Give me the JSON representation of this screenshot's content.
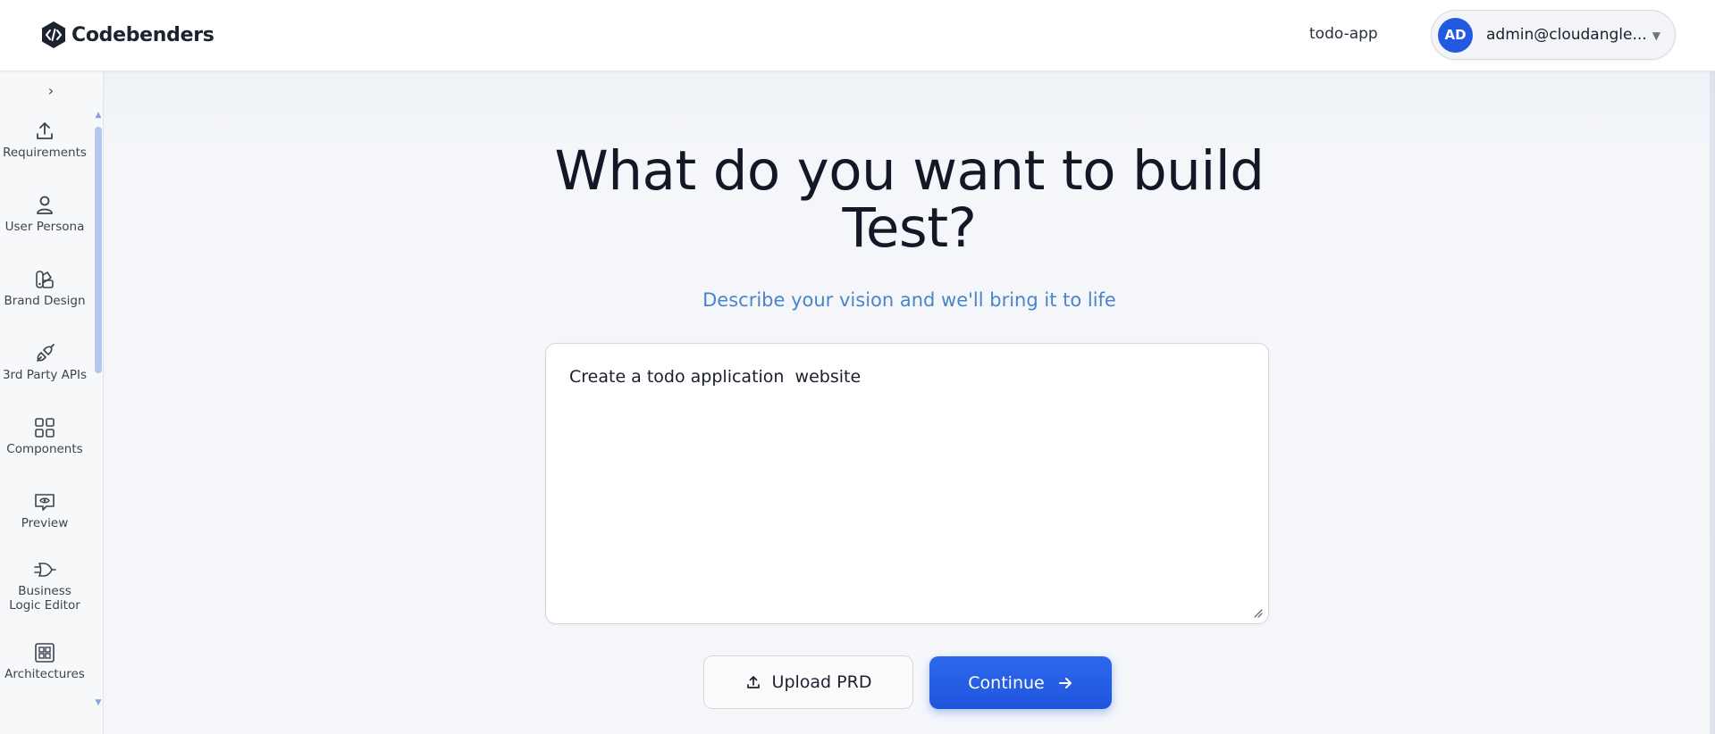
{
  "header": {
    "brand": "Codebenders",
    "project": "todo-app",
    "user": {
      "initials": "AD",
      "email": "admin@cloudangle..."
    }
  },
  "sidebar": {
    "items": [
      {
        "label": "Requirements",
        "icon": "upload-icon"
      },
      {
        "label": "User Persona",
        "icon": "user-icon"
      },
      {
        "label": "Brand Design",
        "icon": "palette-icon"
      },
      {
        "label": "3rd Party APIs",
        "icon": "plug-icon"
      },
      {
        "label": "Components",
        "icon": "grid-icon"
      },
      {
        "label": "Preview",
        "icon": "eye-icon"
      },
      {
        "label": "Business Logic Editor",
        "label_lines": [
          "Business",
          "Logic Editor"
        ],
        "icon": "logic-gate-icon"
      },
      {
        "label": "Architectures",
        "icon": "layout-icon"
      }
    ]
  },
  "main": {
    "title_line1": "What do you want to build",
    "title_line2": "Test?",
    "subtitle": "Describe your vision and we'll bring it to life",
    "prompt_value": "Create a todo application  website",
    "upload_label": "Upload PRD",
    "continue_label": "Continue"
  },
  "colors": {
    "accent": "#2359e0",
    "subtitle": "#4a84c9",
    "background": "#f4f6fa"
  }
}
